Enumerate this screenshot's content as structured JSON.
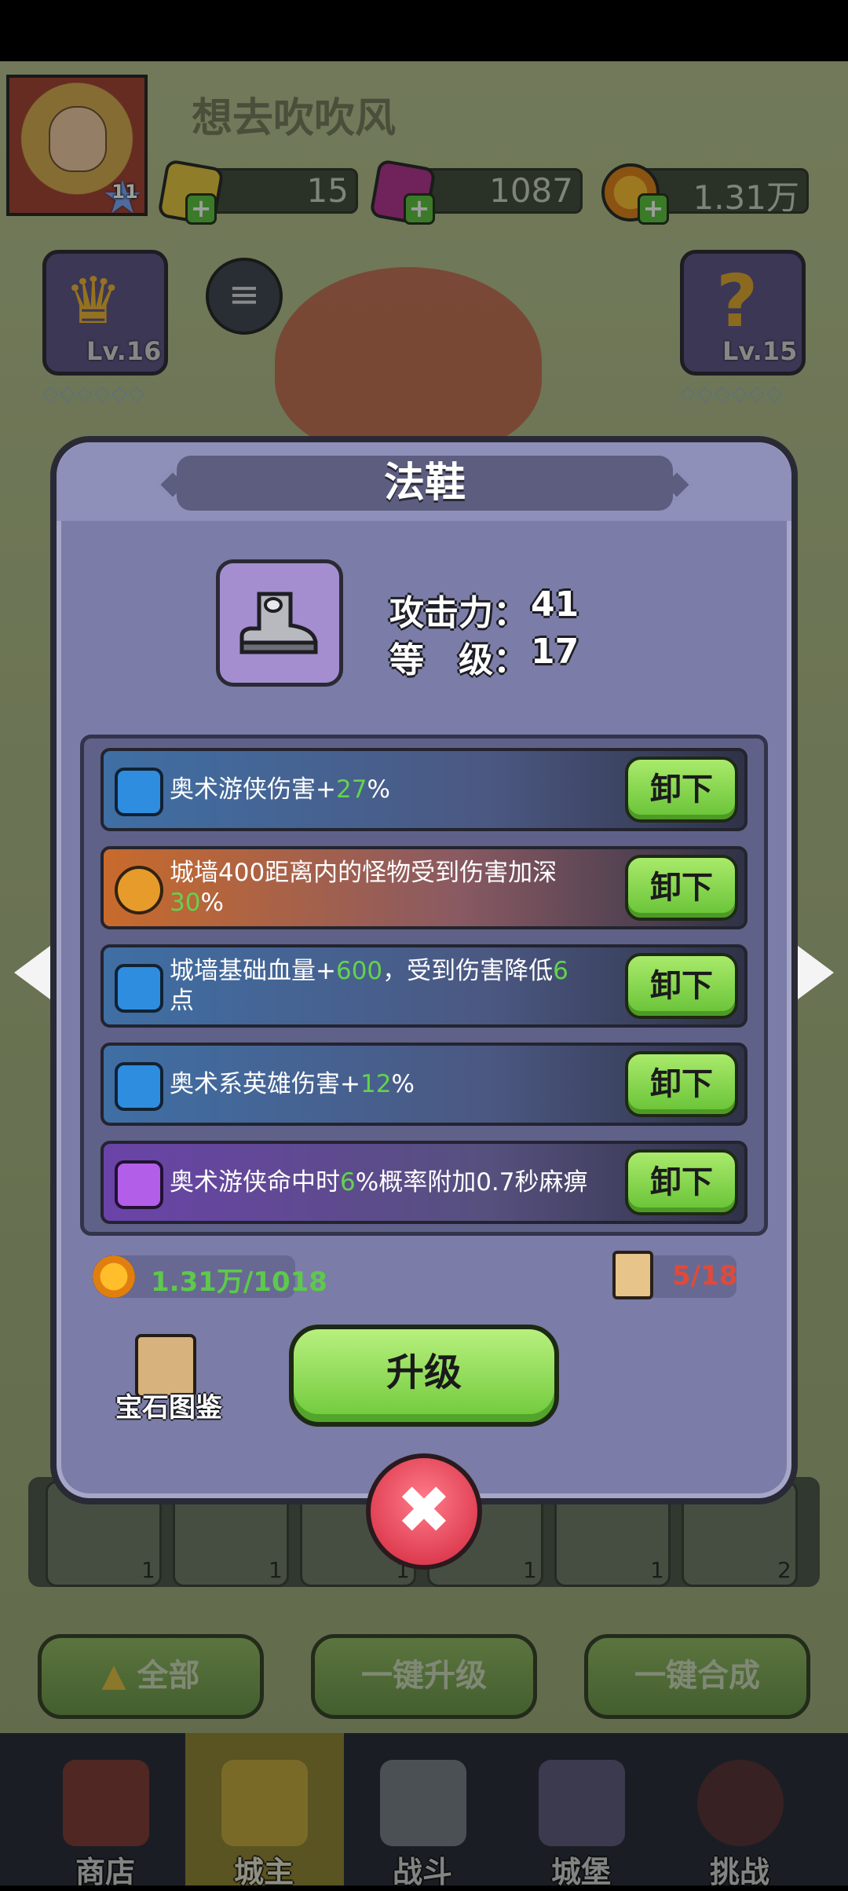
{
  "header": {
    "username": "想去吹吹风",
    "player_level": "11",
    "resources": [
      {
        "icon": "gold-gem-icon",
        "value": "15"
      },
      {
        "icon": "purple-crystal-icon",
        "value": "1087"
      },
      {
        "icon": "coin-icon",
        "value": "1.31万"
      }
    ]
  },
  "equip_slots": {
    "crown_level": "Lv.16",
    "staff_level": "Lv.15"
  },
  "dialog": {
    "title": "法鞋",
    "stats": [
      {
        "label": "攻击力：",
        "value": "41"
      },
      {
        "label": "等　级：",
        "value": "17"
      }
    ],
    "gems": [
      {
        "icon": "blue-gem-icon",
        "color": "#3f6fa4",
        "parts": [
          "奥术游侠伤害+",
          "27",
          "%"
        ],
        "button": "卸下"
      },
      {
        "icon": "orange-gem-icon",
        "color": "#c86a2c",
        "parts": [
          "城墙400距离内的怪物受到伤害加深",
          "30",
          "%"
        ],
        "button": "卸下"
      },
      {
        "icon": "blue-gem-icon",
        "color": "#3f6fa4",
        "parts": [
          "城墙基础血量+",
          "600",
          "，受到伤害降低",
          "6",
          "点"
        ],
        "button": "卸下"
      },
      {
        "icon": "blue-gem-icon",
        "color": "#3f6fa4",
        "parts": [
          "奥术系英雄伤害+",
          "12",
          "%"
        ],
        "button": "卸下"
      },
      {
        "icon": "purple-gem-icon",
        "color": "#6a43a8",
        "parts": [
          "奥术游侠命中时",
          "6",
          "%概率附加0.7秒麻痹"
        ],
        "button": "卸下"
      }
    ],
    "coin_cost": "1.31万/1018",
    "scroll_count": "5/18",
    "gem_book_label": "宝石图鉴",
    "upgrade_label": "升级"
  },
  "inventory_counts": [
    "1",
    "1",
    "1",
    "1",
    "1",
    "2"
  ],
  "bottom_buttons": {
    "all": "全部",
    "one_click_upgrade": "一键升级",
    "one_click_merge": "一键合成"
  },
  "nav": [
    {
      "label": "商店",
      "icon": "shop-icon"
    },
    {
      "label": "城主",
      "icon": "crown-icon"
    },
    {
      "label": "战斗",
      "icon": "swords-icon"
    },
    {
      "label": "城堡",
      "icon": "castle-icon"
    },
    {
      "label": "挑战",
      "icon": "demon-icon"
    }
  ],
  "colors": {
    "highlight_green": "#62d34d",
    "cost_red": "#e04a3a",
    "button_green": "#7fd148",
    "dialog_bg": "#7b7ca7"
  }
}
